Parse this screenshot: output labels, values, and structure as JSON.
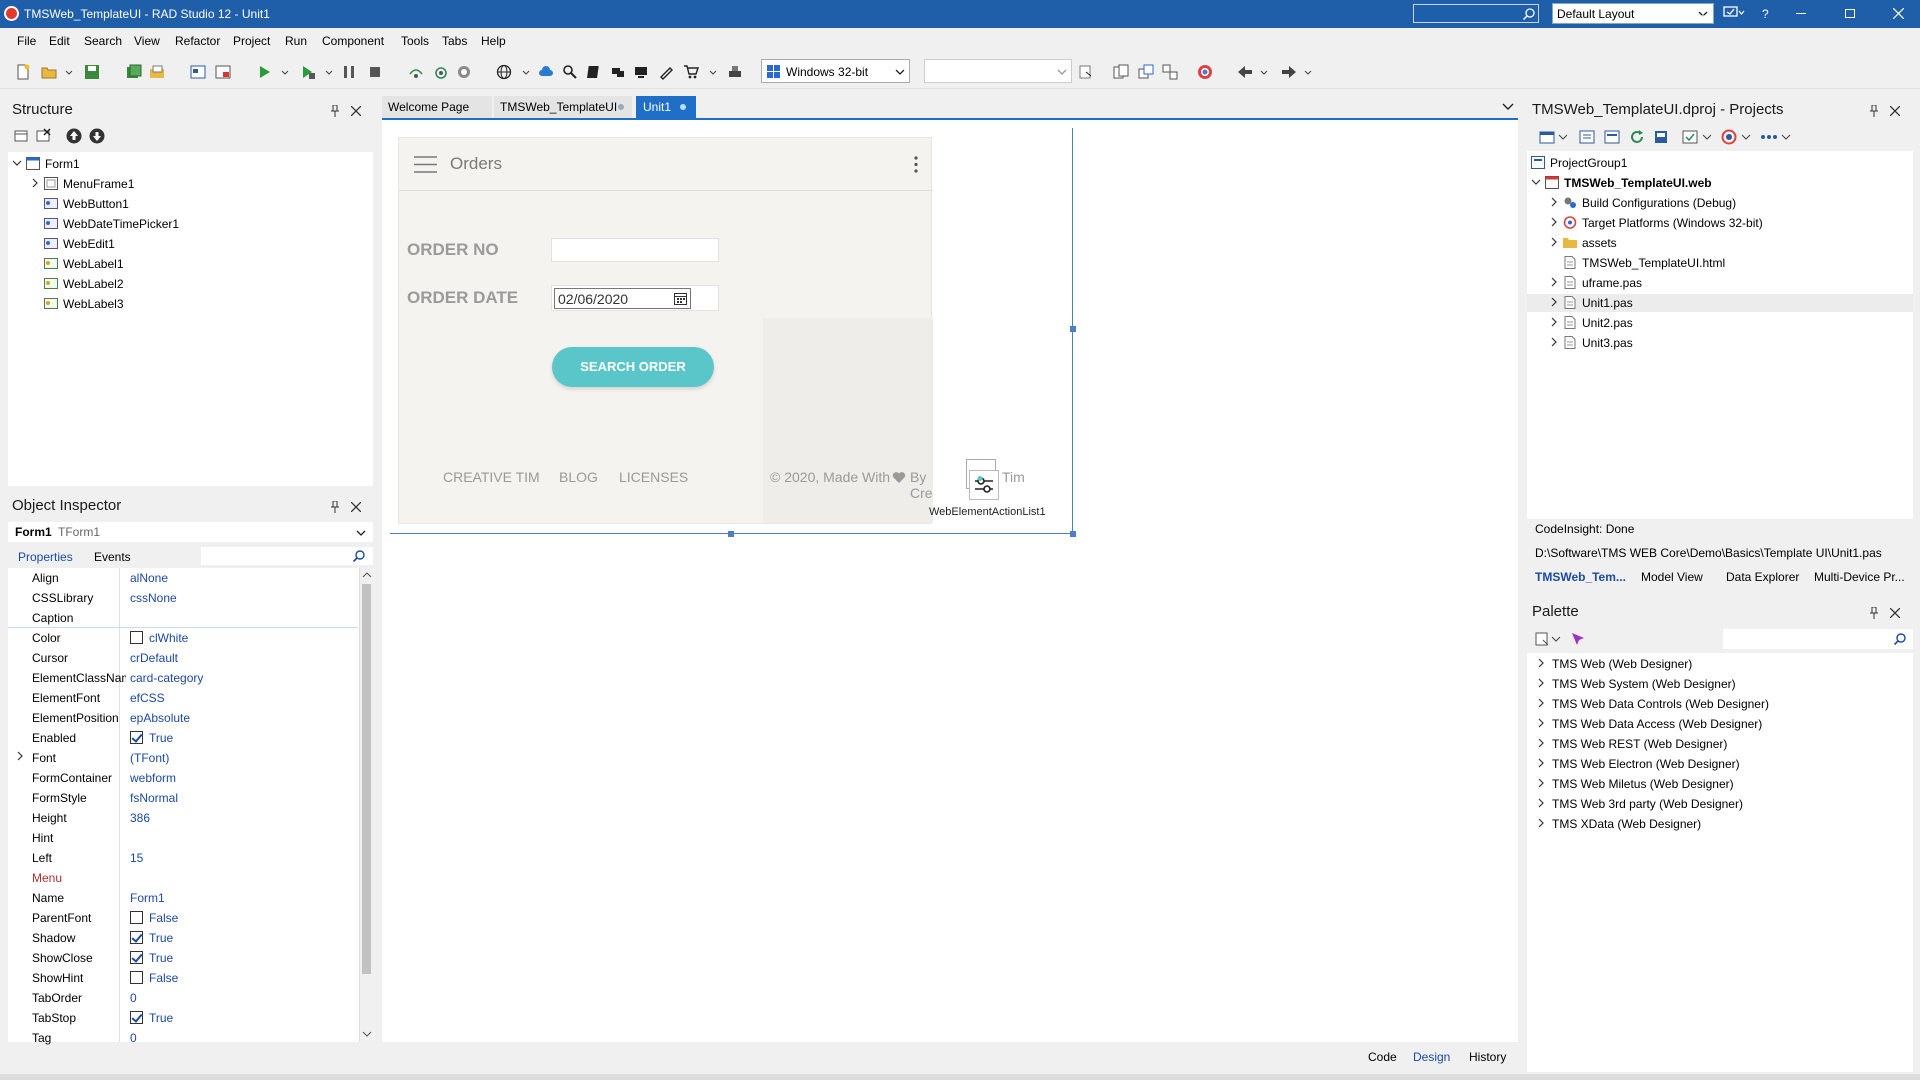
{
  "titlebar": {
    "title": "TMSWeb_TemplateUI - RAD Studio 12 - Unit1",
    "layout": "Default Layout",
    "help": "?"
  },
  "menu": [
    "File",
    "Edit",
    "Search",
    "View",
    "Refactor",
    "Project",
    "Run",
    "Component",
    "Tools",
    "Tabs",
    "Help"
  ],
  "toolbar": {
    "platform": "Windows 32-bit",
    "config_value": ""
  },
  "structure": {
    "title": "Structure",
    "root": "Form1",
    "items": [
      "MenuFrame1",
      "WebButton1",
      "WebDateTimePicker1",
      "WebEdit1",
      "WebLabel1",
      "WebLabel2",
      "WebLabel3"
    ]
  },
  "inspector": {
    "title": "Object Inspector",
    "object_name": "Form1",
    "object_class": "TForm1",
    "tab_properties": "Properties",
    "tab_events": "Events",
    "properties": [
      {
        "name": "Align",
        "value": "alNone"
      },
      {
        "name": "CSSLibrary",
        "value": "cssNone"
      },
      {
        "name": "Caption",
        "value": ""
      },
      {
        "name": "Color",
        "value": "clWhite",
        "check": "empty"
      },
      {
        "name": "Cursor",
        "value": "crDefault"
      },
      {
        "name": "ElementClassName",
        "value": "card-category"
      },
      {
        "name": "ElementFont",
        "value": "efCSS"
      },
      {
        "name": "ElementPosition",
        "value": "epAbsolute"
      },
      {
        "name": "Enabled",
        "value": "True",
        "check": "on"
      },
      {
        "name": "Font",
        "value": "(TFont)",
        "expand": true
      },
      {
        "name": "FormContainer",
        "value": "webform"
      },
      {
        "name": "FormStyle",
        "value": "fsNormal"
      },
      {
        "name": "Height",
        "value": "386"
      },
      {
        "name": "Hint",
        "value": ""
      },
      {
        "name": "Left",
        "value": "15"
      },
      {
        "name": "Menu",
        "value": "",
        "red": true
      },
      {
        "name": "Name",
        "value": "Form1"
      },
      {
        "name": "ParentFont",
        "value": "False",
        "check": "off"
      },
      {
        "name": "Shadow",
        "value": "True",
        "check": "on"
      },
      {
        "name": "ShowClose",
        "value": "True",
        "check": "on"
      },
      {
        "name": "ShowHint",
        "value": "False",
        "check": "off"
      },
      {
        "name": "TabOrder",
        "value": "0"
      },
      {
        "name": "TabStop",
        "value": "True",
        "check": "on"
      },
      {
        "name": "Tag",
        "value": "0"
      }
    ]
  },
  "editor": {
    "tabs": [
      "Welcome Page",
      "TMSWeb_TemplateUI",
      "Unit1"
    ],
    "bottom_tabs": [
      "Code",
      "Design",
      "History"
    ]
  },
  "form": {
    "header_title": "Orders",
    "order_no_label": "ORDER NO",
    "order_no_value": "",
    "order_date_label": "ORDER DATE",
    "order_date_value": "02/06/2020",
    "search_button": "SEARCH ORDER",
    "footer_links": [
      "CREATIVE TIM",
      "BLOG",
      "LICENSES"
    ],
    "copyright_left": "© 2020, Made With",
    "copyright_right": "By Cre",
    "copyright_end": "Tim",
    "action_list": "WebElementActionList1",
    "accent_color": "#5bc6c9"
  },
  "projects": {
    "title": "TMSWeb_TemplateUI.dproj - Projects",
    "group": "ProjectGroup1",
    "project": "TMSWeb_TemplateUI.web",
    "items": [
      {
        "label": "Build Configurations (Debug)",
        "expand": true,
        "icon": "gear"
      },
      {
        "label": "Target Platforms (Windows 32-bit)",
        "expand": true,
        "icon": "target"
      },
      {
        "label": "assets",
        "expand": true,
        "icon": "folder"
      },
      {
        "label": "TMSWeb_TemplateUI.html",
        "expand": false,
        "icon": "file"
      },
      {
        "label": "uframe.pas",
        "expand": true,
        "icon": "file"
      },
      {
        "label": "Unit1.pas",
        "expand": true,
        "icon": "file",
        "selected": true
      },
      {
        "label": "Unit2.pas",
        "expand": true,
        "icon": "file"
      },
      {
        "label": "Unit3.pas",
        "expand": true,
        "icon": "file"
      }
    ],
    "status": "CodeInsight: Done",
    "path": "D:\\Software\\TMS WEB Core\\Demo\\Basics\\Template UI\\Unit1.pas",
    "tabs": [
      "TMSWeb_Tem...",
      "Model View",
      "Data Explorer",
      "Multi-Device Pr..."
    ]
  },
  "palette": {
    "title": "Palette",
    "search_value": "",
    "items": [
      "TMS Web (Web Designer)",
      "TMS Web System (Web Designer)",
      "TMS Web Data Controls (Web Designer)",
      "TMS Web Data Access (Web Designer)",
      "TMS Web REST (Web Designer)",
      "TMS Web Electron (Web Designer)",
      "TMS Web Miletus (Web Designer)",
      "TMS Web 3rd party (Web Designer)",
      "TMS XData (Web Designer)"
    ]
  }
}
